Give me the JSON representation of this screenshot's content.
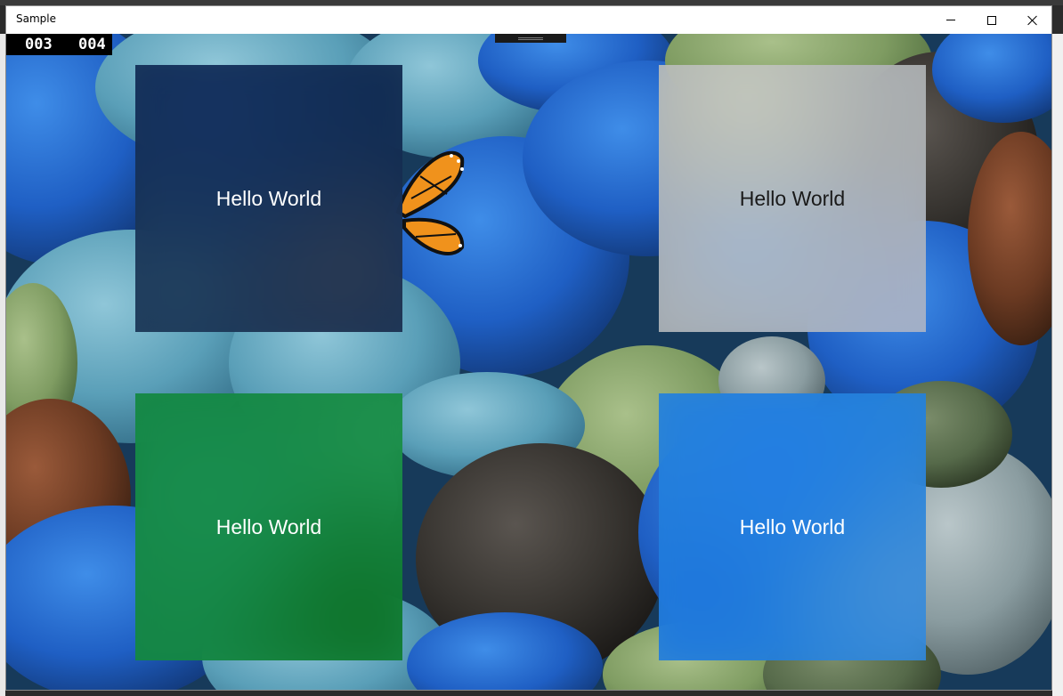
{
  "window": {
    "title": "Sample"
  },
  "caption_buttons": {
    "minimize": "minimize-icon",
    "maximize": "maximize-icon",
    "close": "close-icon"
  },
  "frame_counter": {
    "left": "003",
    "right": "004"
  },
  "tiles": [
    {
      "label": "Hello World",
      "tint": "#0f2444",
      "tint_opacity": 0.78,
      "text_color": "#ffffff"
    },
    {
      "label": "Hello World",
      "tint": "#c8c8c8",
      "tint_opacity": 0.72,
      "text_color": "#1a1a1a"
    },
    {
      "label": "Hello World",
      "tint": "#0d8a2e",
      "tint_opacity": 0.8,
      "text_color": "#ffffff"
    },
    {
      "label": "Hello World",
      "tint": "#1e7fe0",
      "tint_opacity": 0.72,
      "text_color": "#ffffff"
    }
  ],
  "colors": {
    "wallpaper_base": "#2f6fa8",
    "butterfly": "#f0921c"
  }
}
